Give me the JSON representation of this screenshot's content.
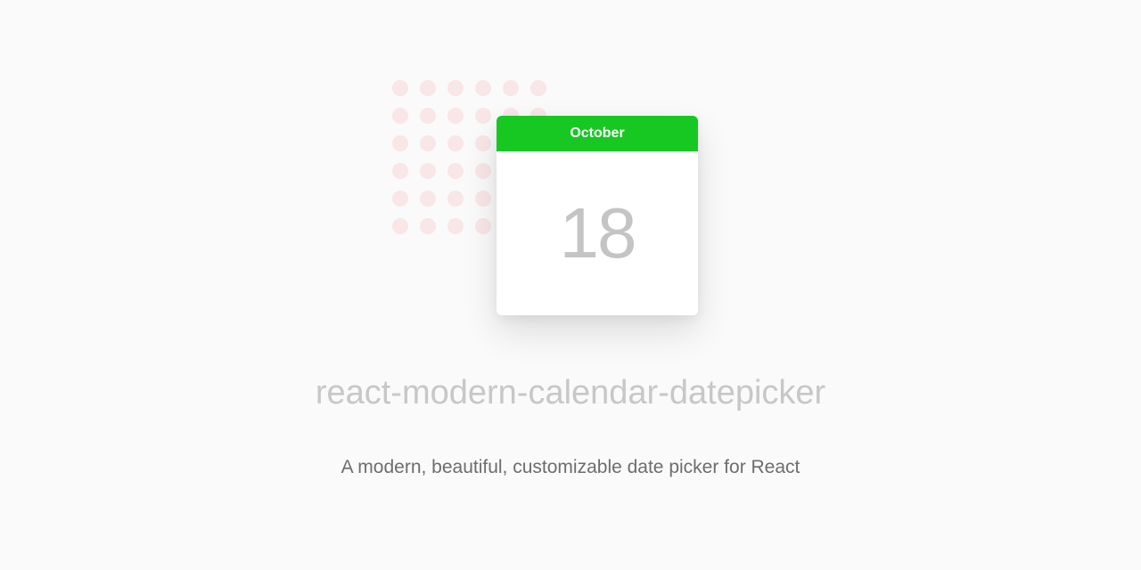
{
  "calendar": {
    "month": "October",
    "day": "18"
  },
  "title": "react-modern-calendar-datepicker",
  "subtitle": "A modern, beautiful, customizable date picker for React",
  "colors": {
    "accent": "#17c823",
    "dot": "#f9e6e6",
    "titleColor": "#c7c7c7",
    "subtitleColor": "#6d6d6d",
    "dayColor": "#c4c4c4",
    "background": "#fafafa"
  }
}
